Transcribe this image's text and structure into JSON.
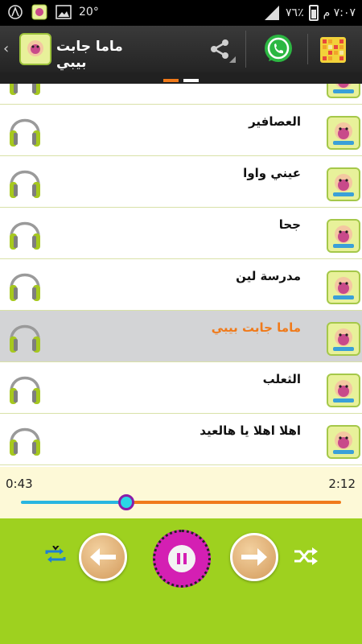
{
  "status_bar": {
    "temperature": "20°",
    "battery_percent": "٧٦٪",
    "clock": "٧:٠٧ م",
    "icons": [
      "status-a-icon",
      "app-notification-icon",
      "image-icon",
      "signal-icon",
      "battery-icon"
    ]
  },
  "action_bar": {
    "title": "ماما جابت بيبي",
    "icons": [
      "back-chevron-icon",
      "app-logo-icon",
      "share-icon",
      "whatsapp-icon",
      "more-apps-icon"
    ]
  },
  "tabs": {
    "count": 2,
    "active_index": 0,
    "active_color": "#f07a1a",
    "inactive_color": "#ffffff"
  },
  "songs": [
    {
      "title": "",
      "selected": false,
      "partial": true
    },
    {
      "title": "العصافير",
      "selected": false
    },
    {
      "title": "عيني واوا",
      "selected": false
    },
    {
      "title": "جحا",
      "selected": false
    },
    {
      "title": "مدرسة لين",
      "selected": false
    },
    {
      "title": "ماما جابت بيبي",
      "selected": true
    },
    {
      "title": "الثعلب",
      "selected": false
    },
    {
      "title": "اهلا اهلا يا هالعيد",
      "selected": false
    }
  ],
  "player": {
    "elapsed": "0:43",
    "duration": "2:12",
    "progress_fraction": 0.33,
    "played_color": "#29b6e0",
    "remaining_color": "#f07a1a",
    "controls": [
      "repeat-icon",
      "previous-icon",
      "pause-icon",
      "next-icon",
      "shuffle-icon"
    ]
  },
  "colors": {
    "accent_green": "#9ed11f",
    "selected_row": "#d3d4d6",
    "selected_text": "#f07a1a",
    "pause_magenta": "#d41fb3"
  }
}
